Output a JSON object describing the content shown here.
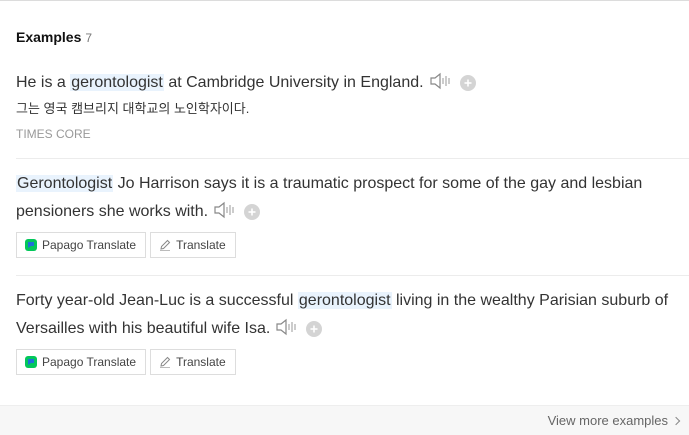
{
  "section": {
    "title": "Examples",
    "count": "7"
  },
  "examples": [
    {
      "pre": "He is a ",
      "highlight": "gerontologist",
      "post": " at Cambridge University in England.",
      "translation": "그는 영국 캠브리지 대학교의 노인학자이다.",
      "source": "TIMES CORE"
    },
    {
      "pre": "",
      "highlight": "Gerontologist",
      "post": " Jo Harrison says it is a traumatic prospect for some of the gay and lesbian pensioners she works with.",
      "buttons": {
        "papago": "Papago Translate",
        "translate": "Translate"
      }
    },
    {
      "pre": "Forty year-old Jean-Luc is a successful ",
      "highlight": "gerontologist",
      "post": " living in the wealthy Parisian suburb of Versailles with his beautiful wife Isa.",
      "buttons": {
        "papago": "Papago Translate",
        "translate": "Translate"
      }
    }
  ],
  "footer": {
    "view_more": "View more examples"
  },
  "colors": {
    "highlight_bg": "#e9f3fd",
    "papago_green": "#03c75a",
    "papago_blue": "#1e6fd9"
  }
}
